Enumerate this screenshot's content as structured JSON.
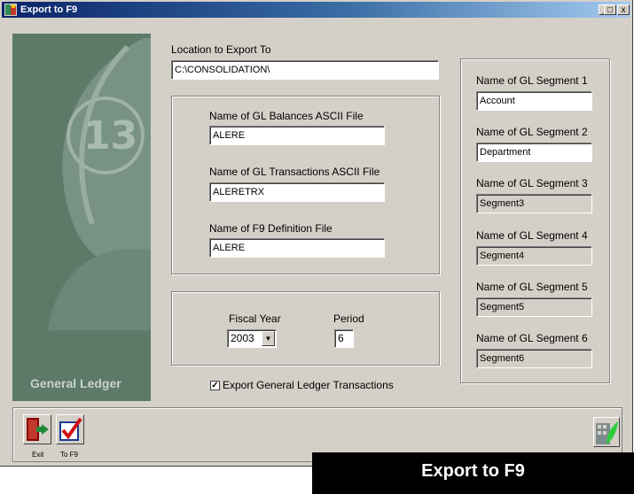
{
  "window": {
    "title": "Export to F9",
    "minimize": "_",
    "maximize": "□",
    "close": "x"
  },
  "left_panel": {
    "module_name": "General Ledger"
  },
  "location": {
    "label": "Location to Export To",
    "value": "C:\\CONSOLIDATION\\"
  },
  "files": {
    "balances_label": "Name of GL Balances ASCII File",
    "balances_value": "ALERE",
    "transactions_label": "Name of GL Transactions ASCII File",
    "transactions_value": "ALERETRX",
    "definition_label": "Name of F9 Definition File",
    "definition_value": "ALERE"
  },
  "period_group": {
    "fiscal_year_label": "Fiscal Year",
    "fiscal_year_value": "2003",
    "period_label": "Period",
    "period_value": "6"
  },
  "export_transactions": {
    "label": "Export General Ledger Transactions",
    "checked": true
  },
  "segments": [
    {
      "label": "Name of GL Segment 1",
      "value": "Account",
      "enabled": true
    },
    {
      "label": "Name of GL Segment 2",
      "value": "Department",
      "enabled": true
    },
    {
      "label": "Name of GL Segment 3",
      "value": "Segment3",
      "enabled": false
    },
    {
      "label": "Name of GL Segment 4",
      "value": "Segment4",
      "enabled": false
    },
    {
      "label": "Name of GL Segment 5",
      "value": "Segment5",
      "enabled": false
    },
    {
      "label": "Name of GL Segment 6",
      "value": "Segment6",
      "enabled": false
    }
  ],
  "toolbar": {
    "exit_label": "Exit",
    "to_f9_label": "To F9"
  },
  "banner": {
    "text": "Export to F9"
  }
}
